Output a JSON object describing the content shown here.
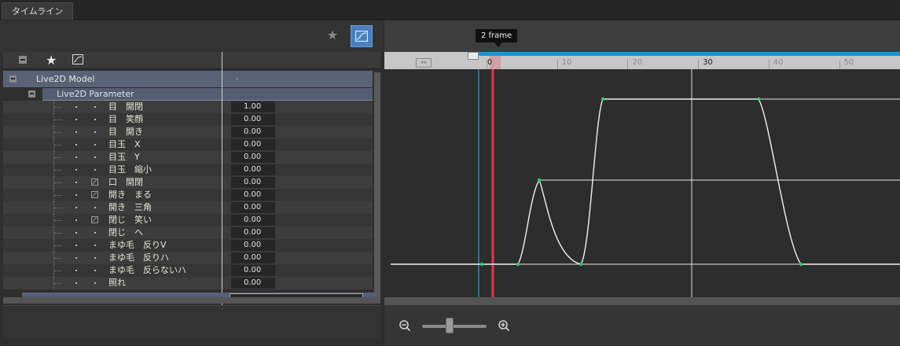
{
  "tab": {
    "label": "タイムライン"
  },
  "tree": {
    "model_label": "Live2D Model",
    "model_value": "·",
    "param_label": "Live2D Parameter",
    "items": [
      {
        "name": "目　開閉",
        "value": "1.00",
        "icon": "dot"
      },
      {
        "name": "目　笑顔",
        "value": "0.00",
        "icon": "dot"
      },
      {
        "name": "目　開き",
        "value": "0.00",
        "icon": "dot"
      },
      {
        "name": "目玉　X",
        "value": "0.00",
        "icon": "dot"
      },
      {
        "name": "目玉　Y",
        "value": "0.00",
        "icon": "dot"
      },
      {
        "name": "目玉　縮小",
        "value": "0.00",
        "icon": "dot"
      },
      {
        "name": "口　開閉",
        "value": "0.00",
        "icon": "curve"
      },
      {
        "name": "開き　まる",
        "value": "0.00",
        "icon": "curve"
      },
      {
        "name": "開き　三角",
        "value": "0.00",
        "icon": "dot"
      },
      {
        "name": "閉じ　笑い",
        "value": "0.00",
        "icon": "curve"
      },
      {
        "name": "閉じ　へ",
        "value": "0.00",
        "icon": "dot"
      },
      {
        "name": "まゆ毛　反りV",
        "value": "0.00",
        "icon": "dot"
      },
      {
        "name": "まゆ毛　反りハ",
        "value": "0.00",
        "icon": "dot"
      },
      {
        "name": "まゆ毛　反らないハ",
        "value": "0.00",
        "icon": "dot"
      },
      {
        "name": "照れ",
        "value": "0.00",
        "icon": "dot"
      }
    ]
  },
  "timeline": {
    "current_frame_label": "2 frame",
    "fit_icon": "↔",
    "ruler_labels": [
      "0",
      "10",
      "20",
      "30",
      "40",
      "50"
    ],
    "colors": {
      "playhead": "#e8334a",
      "ruler_accent": "#1e90d6",
      "active_button": "#4a80c0",
      "keyframe": "#2ecc71"
    }
  },
  "icons": {
    "favorite": "star-icon",
    "curve_editor": "curve-icon",
    "zoom_out": "zoom-out-icon",
    "zoom_in": "zoom-in-icon"
  }
}
